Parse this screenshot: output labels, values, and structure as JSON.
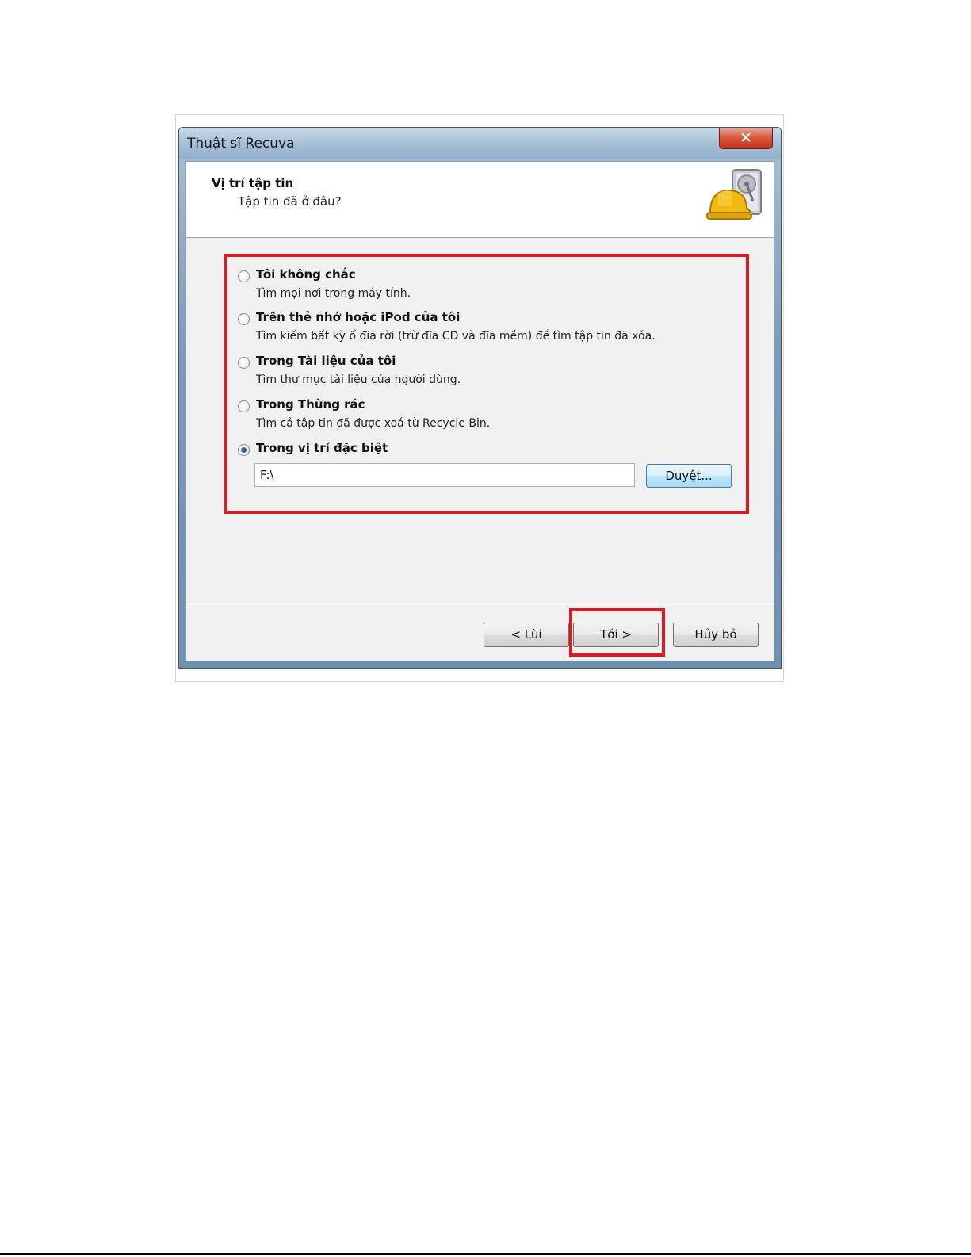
{
  "window": {
    "title": "Thuật sĩ Recuva",
    "close_label": "×"
  },
  "header": {
    "title": "Vị trí tập tin",
    "subtitle": "Tập tin đã ở đâu?",
    "icon": "recuva-hardhat-icon"
  },
  "options": [
    {
      "title": "Tôi không chắc",
      "desc": "Tìm mọi nơi trong máy tính.",
      "checked": false
    },
    {
      "title": "Trên thẻ nhớ hoặc iPod của tôi",
      "desc": "Tìm kiếm bất kỳ ổ đĩa rời (trừ đĩa CD và đĩa mềm) để tìm tập tin đã xóa.",
      "checked": false
    },
    {
      "title": "Trong Tài liệu của tôi",
      "desc": "Tìm thư mục tài liệu của người dùng.",
      "checked": false
    },
    {
      "title": "Trong Thùng rác",
      "desc": "Tìm cả tập tin đã được xoá từ Recycle Bin.",
      "checked": false
    },
    {
      "title": "Trong vị trí đặc biệt",
      "desc": "",
      "checked": true
    }
  ],
  "location": {
    "value": "F:\\",
    "browse_label": "Duyệt..."
  },
  "footer": {
    "back_label": "< Lùi",
    "next_label": "Tới >",
    "cancel_label": "Hủy bỏ"
  },
  "colors": {
    "highlight": "#d81c24",
    "title_bar": "#a7bfd7",
    "client_bg": "#f0f0f0"
  }
}
